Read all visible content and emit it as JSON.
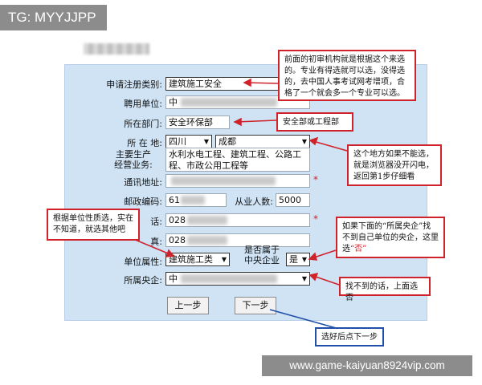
{
  "watermark_top": "TG: MYYJJPP",
  "watermark_bottom": "www.game-kaiyuan8924vip.com",
  "form": {
    "rows": {
      "category": {
        "label": "申请注册类别:",
        "value": "建筑施工安全"
      },
      "employer": {
        "label": "聘用单位:",
        "value": "中"
      },
      "department": {
        "label": "所在部门:",
        "value": "安全环保部"
      },
      "location": {
        "label": "所 在 地:",
        "province": "四川",
        "city": "成都"
      },
      "business": {
        "label": "主要生产\n经营业务:",
        "value": "水利水电工程、建筑工程、公路工程、市政公用工程等"
      },
      "address": {
        "label": "通讯地址:",
        "value": ""
      },
      "postcode": {
        "label": "邮政编码:",
        "value": "61",
        "staff_label": "从业人数:",
        "staff_value": "5000"
      },
      "phone": {
        "label": "话:",
        "value": "028"
      },
      "fax": {
        "label": "真:",
        "value": "028"
      },
      "unit_type": {
        "label": "单位属性:",
        "value": "建筑施工类",
        "central_label": "是否属于\n中央企业",
        "central_value": "是"
      },
      "central": {
        "label": "所属央企:",
        "value": "中"
      }
    },
    "required_mark": "*",
    "prev_button": "上一步",
    "next_button": "下一步"
  },
  "callouts": {
    "top": "前面的初审机构就是根据这个来选的。专业有得选就可以选，没得选的，去中国人事考试网考增项，合格了一个就会多一个专业可以选。",
    "department": "安全部或工程部",
    "browser": "这个地方如果不能选，就是浏览器没开闪电，返回第1步仔细看",
    "unit_type": "根据单位性质选，实在不知道，就选其他吧",
    "central_if": "如果下面的“所属央企”找不到自己单位的央企，这里选",
    "central_no": "“否”",
    "central_notfound": "找不到的话，上面选否",
    "next_tip": "选好后点下一步"
  },
  "colors": {
    "panel": "#cfe3f5",
    "callout_border": "#d0222a",
    "callout_blue": "#1f4fa8"
  }
}
